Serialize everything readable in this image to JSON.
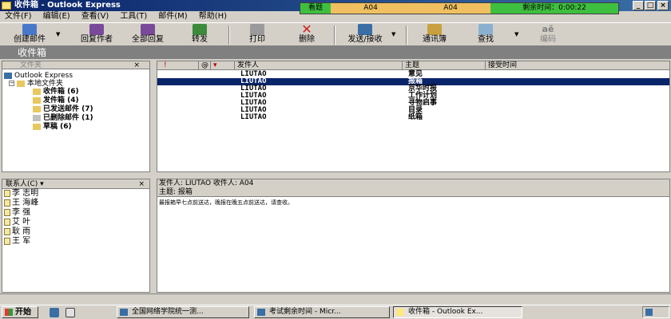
{
  "window": {
    "title": "收件箱 - Outlook Express",
    "controls": {
      "minimize": "_",
      "maximize": "□",
      "close": "×"
    }
  },
  "exam": {
    "view_label": "看题",
    "field_1": "A04",
    "field_2": "A04",
    "timer": "剩余时间：0:00:22"
  },
  "menu": [
    "文件(F)",
    "编辑(E)",
    "查看(V)",
    "工具(T)",
    "邮件(M)",
    "帮助(H)"
  ],
  "toolbar": {
    "create": "创建邮件",
    "reply": "回复作者",
    "reply_all": "全部回复",
    "forward": "转发",
    "print": "打印",
    "delete": "删除",
    "send_receive": "发送/接收",
    "address_book": "通讯簿",
    "find": "查找",
    "encoding": "编码"
  },
  "folder_band": "收件箱",
  "folders": {
    "header": "文件夹",
    "close": "×",
    "root": "Outlook Express",
    "local": "本地文件夹",
    "items": [
      {
        "label": "收件箱 (6)"
      },
      {
        "label": "发件箱 (4)"
      },
      {
        "label": "已发送邮件 (7)"
      },
      {
        "label": "已删除邮件 (1)"
      },
      {
        "label": "草稿 (6)"
      }
    ]
  },
  "contacts": {
    "header": "联系人(C) ▾",
    "close": "×",
    "items": [
      "李 志明",
      "王 海峰",
      "李 强",
      "艾 叶",
      "耿 雨",
      "王 军"
    ]
  },
  "message_list": {
    "columns": {
      "flag": "!",
      "attach": "@",
      "mark": "▾",
      "from": "发件人",
      "subject": "主题",
      "received": "接受时间"
    },
    "rows": [
      {
        "from": "LIUTAO",
        "subject": "意见",
        "selected": false
      },
      {
        "from": "LIUTAO",
        "subject": "报箱",
        "selected": true
      },
      {
        "from": "LIUTAO",
        "subject": "京华时报",
        "selected": false
      },
      {
        "from": "LIUTAO",
        "subject": "工作计划",
        "selected": false
      },
      {
        "from": "LIUTAO",
        "subject": "寻物启事",
        "selected": false
      },
      {
        "from": "LIUTAO",
        "subject": "目录",
        "selected": false
      },
      {
        "from": "LIUTAO",
        "subject": "纸箱",
        "selected": false
      }
    ]
  },
  "preview": {
    "from_line": "发件人: LIUTAO   收件人: A04",
    "subject_line": "主题: 报箱",
    "body": "最报箱早七点前送达，晚报在晚五点前送达，请查收。"
  },
  "taskbar": {
    "start": "开始",
    "tasks": [
      {
        "label": "全国网络学院统一测..."
      },
      {
        "label": "考试剩余时间 - Micr..."
      },
      {
        "label": "收件箱 - Outlook Ex..."
      }
    ]
  }
}
